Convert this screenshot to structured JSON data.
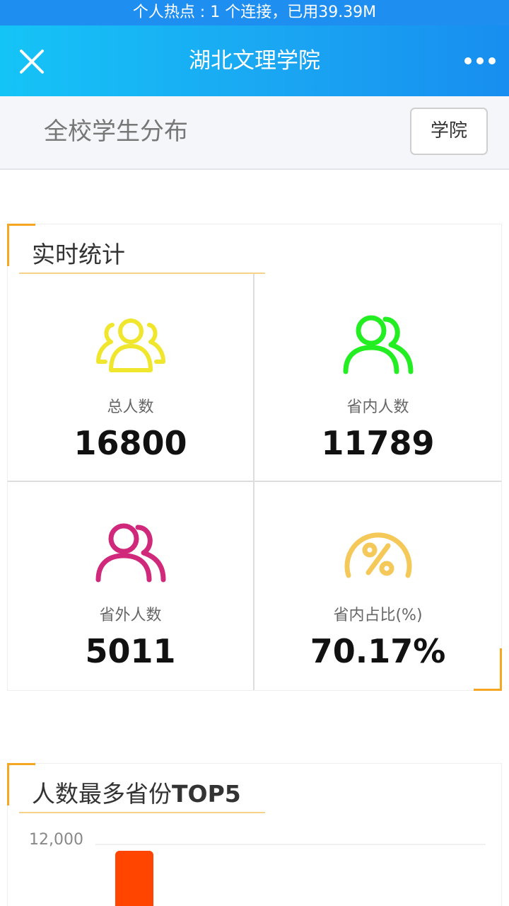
{
  "status_bar": {
    "text": "个人热点 : 1 个连接，已用39.39M"
  },
  "title_bar": {
    "title": "湖北文理学院",
    "close_icon": "close-icon",
    "more_icon": "more-horizontal-icon"
  },
  "sub_header": {
    "title": "全校学生分布",
    "button_label": "学院"
  },
  "stats_panel": {
    "heading": "实时统计",
    "items": [
      {
        "label": "总人数",
        "value": "16800",
        "icon": "users-group-icon",
        "color": "#f0e62e"
      },
      {
        "label": "省内人数",
        "value": "11789",
        "icon": "users-pair-icon",
        "color": "#22ee22"
      },
      {
        "label": "省外人数",
        "value": "5011",
        "icon": "users-pair-icon",
        "color": "#d0287a"
      },
      {
        "label": "省内占比(%)",
        "value": "70.17%",
        "icon": "percent-gauge-icon",
        "color": "#f5c85a"
      }
    ]
  },
  "top5_panel": {
    "heading_prefix": "人数最多省份",
    "heading_bold": "TOP5",
    "chart_data": {
      "type": "bar",
      "y_tick_label": "12,000",
      "ylim": [
        0,
        12000
      ],
      "bar_color": "#ff4500",
      "categories": [],
      "values": []
    }
  },
  "colors": {
    "accent": "#f5a623",
    "header_start": "#15c4f7",
    "header_end": "#178ef0"
  }
}
